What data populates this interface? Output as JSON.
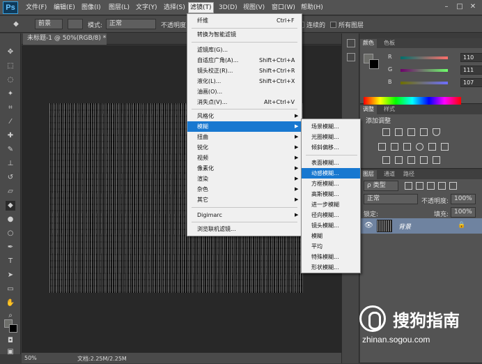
{
  "app": {
    "logo": "Ps",
    "menu": [
      "文件(F)",
      "编辑(E)",
      "图像(I)",
      "图层(L)",
      "文字(Y)",
      "选择(S)",
      "滤镜(T)",
      "3D(D)",
      "视图(V)",
      "窗口(W)",
      "帮助(H)"
    ],
    "active_menu_index": 6,
    "window_controls": [
      "–",
      "□",
      "✕"
    ]
  },
  "options": {
    "source_label": "前景",
    "mode_label": "模式:",
    "mode_value": "正常",
    "opacity_label": "不透明度:",
    "contiguous_label": "连续的",
    "all_layers_label": "所有图层"
  },
  "document": {
    "tab_title": "未标题-1 @ 50%(RGB/8) *",
    "zoom": "50%",
    "doc_info": "文档:2.25M/2.25M"
  },
  "filter_menu": {
    "items": [
      {
        "label": "纤维",
        "shortcut": "Ctrl+F"
      },
      {
        "label": "转换为智能滤镜",
        "shortcut": ""
      },
      {
        "label": "滤镜库(G)...",
        "shortcut": ""
      },
      {
        "label": "自适应广角(A)...",
        "shortcut": "Shift+Ctrl+A"
      },
      {
        "label": "镜头校正(R)...",
        "shortcut": "Shift+Ctrl+R"
      },
      {
        "label": "液化(L)...",
        "shortcut": "Shift+Ctrl+X"
      },
      {
        "label": "油画(O)...",
        "shortcut": ""
      },
      {
        "label": "消失点(V)...",
        "shortcut": "Alt+Ctrl+V"
      },
      {
        "label": "风格化",
        "shortcut": ""
      },
      {
        "label": "模糊",
        "shortcut": ""
      },
      {
        "label": "扭曲",
        "shortcut": ""
      },
      {
        "label": "锐化",
        "shortcut": ""
      },
      {
        "label": "视频",
        "shortcut": ""
      },
      {
        "label": "像素化",
        "shortcut": ""
      },
      {
        "label": "渲染",
        "shortcut": ""
      },
      {
        "label": "杂色",
        "shortcut": ""
      },
      {
        "label": "其它",
        "shortcut": ""
      },
      {
        "label": "Digimarc",
        "shortcut": ""
      },
      {
        "label": "浏览联机滤镜...",
        "shortcut": ""
      }
    ],
    "highlighted_index": 9
  },
  "blur_submenu": {
    "items": [
      "场景模糊...",
      "光圈模糊...",
      "倾斜偏移...",
      "表面模糊...",
      "动感模糊...",
      "方框模糊...",
      "高斯模糊...",
      "进一步模糊",
      "径向模糊...",
      "镜头模糊...",
      "模糊",
      "平均",
      "特殊模糊...",
      "形状模糊..."
    ],
    "highlighted_index": 4
  },
  "color_panel": {
    "tabs": [
      "颜色",
      "色板"
    ],
    "r_label": "R",
    "g_label": "G",
    "b_label": "B",
    "r": "110",
    "g": "111",
    "b": "107"
  },
  "adjustments_panel": {
    "tabs": [
      "调整",
      "样式"
    ],
    "title": "添加调整"
  },
  "layers_panel": {
    "tabs": [
      "图层",
      "通道",
      "路径"
    ],
    "filter_label": "ρ 类型",
    "blend_mode": "正常",
    "opacity_label": "不透明度:",
    "opacity_value": "100%",
    "lock_label": "锁定:",
    "fill_label": "填充:",
    "fill_value": "100%",
    "layer_name": "背景"
  },
  "watermark": {
    "name": "搜狗指南",
    "url": "zhinan.sogou.com"
  },
  "colors": {
    "menu_highlight": "#1878d0",
    "layer_selected": "#6f83a0"
  }
}
